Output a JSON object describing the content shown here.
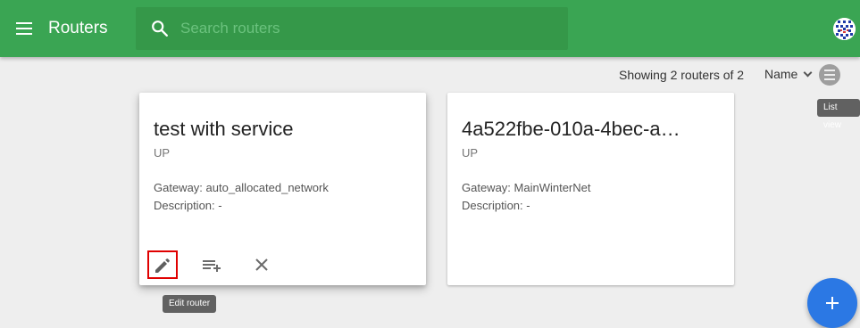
{
  "appbar": {
    "title": "Routers",
    "search_placeholder": "Search routers",
    "search_value": "",
    "menu_icon": "menu-icon",
    "search_icon": "search-icon",
    "avatar_icon": "user-avatar",
    "background_color": "#3aa553"
  },
  "toolbar": {
    "results_text": "Showing 2 routers of 2",
    "sort_label": "Name",
    "view_toggle_tooltip": "List view"
  },
  "routers": [
    {
      "name": "test with service",
      "status": "UP",
      "gateway": "Gateway: auto_allocated_network",
      "description": "Description: -"
    },
    {
      "name": "4a522fbe-010a-4bec-a…",
      "status": "UP",
      "gateway": "Gateway: MainWinterNet",
      "description": "Description: -"
    }
  ],
  "card_actions": {
    "edit_tooltip": "Edit router",
    "edit_icon": "pencil-icon",
    "add_icon": "playlist-add-icon",
    "delete_icon": "close-icon"
  },
  "fab": {
    "icon": "plus-icon",
    "color": "#2b78e4"
  }
}
